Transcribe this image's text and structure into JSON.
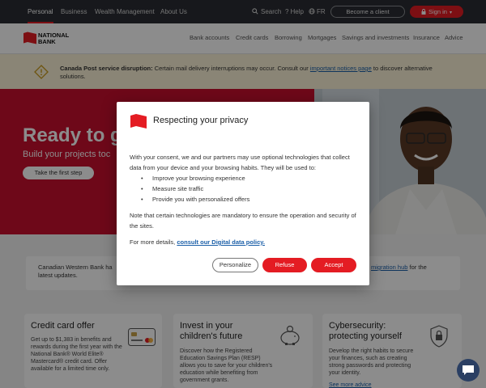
{
  "topbar": {
    "tabs": [
      "Personal",
      "Business",
      "Wealth Management",
      "About Us"
    ],
    "search_label": "Search",
    "help_label": "Help",
    "language_label": "FR",
    "become_client_label": "Become a client",
    "signin_label": "Sign in"
  },
  "brand": {
    "line1": "NATIONAL",
    "line2": "BANK"
  },
  "nav": {
    "items": [
      "Bank accounts",
      "Credit cards",
      "Borrowing",
      "Mortgages",
      "Savings and investments",
      "Insurance",
      "Advice"
    ]
  },
  "alert": {
    "title": "Canada Post service disruption:",
    "text": "Certain mail delivery interruptions may occur. Consult our",
    "link": "important notices page",
    "text_after": "to discover alternative",
    "text_line2": "solutions."
  },
  "hero": {
    "title": "Ready to g",
    "subtitle": "Build your projects toc",
    "button_label": "Take the first step"
  },
  "notice": {
    "text_before": "Canadian Western Bank ha",
    "link": "migration hub",
    "text_after": "for the",
    "text_line2": "latest updates."
  },
  "cards": [
    {
      "title": "Credit card offer",
      "body": "Get up to $1,383 in benefits and rewards during the first year with the National Bank® World Elite® Mastercard® credit card. Offer available for a limited time only."
    },
    {
      "title_line1": "Invest in your",
      "title_line2": "children's future",
      "body": "Discover how the Registered Education Savings Plan (RESP) allows you to save for your children's education while benefiting from government grants."
    },
    {
      "title_line1": "Cybersecurity:",
      "title_line2": "protecting yourself",
      "body": "Develop the right habits to secure your finances, such as creating strong passwords and protecting your identity.",
      "link": "See more advice"
    }
  ],
  "privacy_modal": {
    "title": "Respecting your privacy",
    "intro": "With your consent, we and our partners may use optional technologies that collect data from your device and your browsing habits. They will be used to:",
    "uses": [
      "Improve your browsing experience",
      "Measure site traffic",
      "Provide you with personalized offers"
    ],
    "note": "Note that certain technologies are mandatory to ensure the operation and security of the sites.",
    "details_prefix": "For more details,",
    "details_link": "consult our Digital data policy.",
    "buttons": {
      "personalize": "Personalize",
      "refuse": "Refuse",
      "accept": "Accept"
    }
  },
  "colors": {
    "brand_red": "#e41c23",
    "topbar": "#2a2d33",
    "hero": "#c8102e",
    "alert_bg": "#fbf3d7",
    "link": "#1b5fa8"
  }
}
